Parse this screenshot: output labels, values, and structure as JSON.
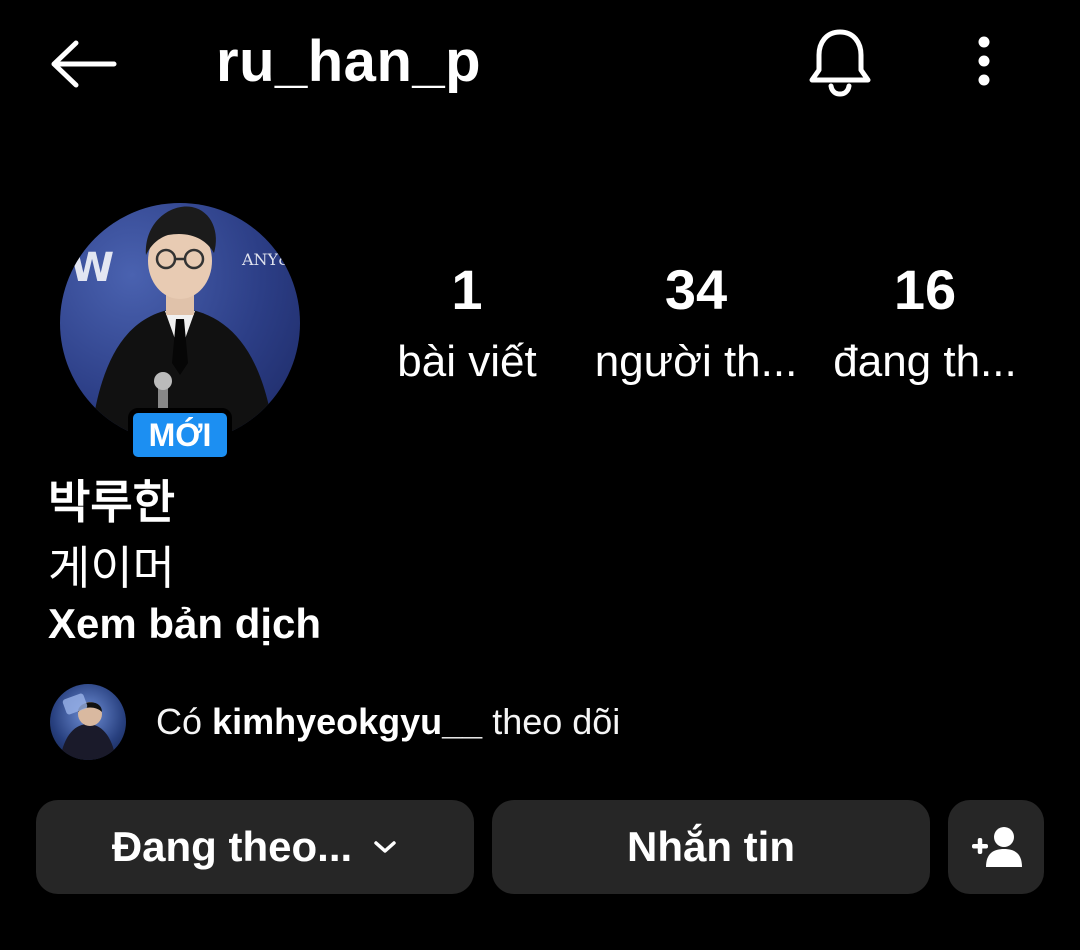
{
  "header": {
    "username": "ru_han_p"
  },
  "profile": {
    "new_badge": "MỚI",
    "display_name": "박루한",
    "bio": "게이머",
    "translate_link": "Xem bản dịch"
  },
  "stats": {
    "posts": {
      "value": "1",
      "label": "bài viết"
    },
    "followers": {
      "value": "34",
      "label": "người th..."
    },
    "following": {
      "value": "16",
      "label": "đang th..."
    }
  },
  "mutual": {
    "prefix": "Có",
    "username": "kimhyeokgyu__",
    "suffix": "theo dõi"
  },
  "actions": {
    "following_label": "Đang theo...",
    "message_label": "Nhắn tin"
  },
  "icons": {
    "back": "arrow-left-icon",
    "notifications": "bell-icon",
    "more": "more-vertical-icon",
    "dropdown": "chevron-down-icon",
    "add_user": "add-person-icon"
  },
  "colors": {
    "background": "#000000",
    "button": "#262626",
    "badge": "#1c8ff2"
  }
}
